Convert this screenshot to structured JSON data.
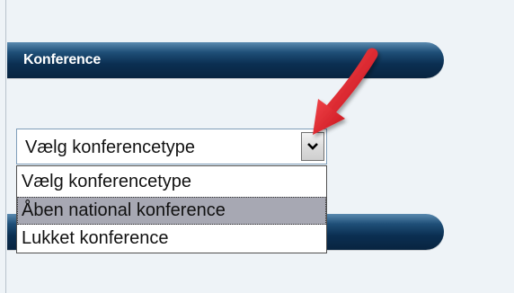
{
  "section_top": {
    "title": "Konference"
  },
  "section_bottom": {
    "title": ""
  },
  "conference_type_select": {
    "selected_value": "Vælg konferencetype",
    "options": [
      "Vælg konferencetype",
      "Åben national konference",
      "Lukket konference"
    ],
    "highlighted_option": "Åben national konference"
  },
  "colors": {
    "header_bar_dark": "#0b2f52",
    "header_bar_light": "#5a8ab0",
    "highlight_option_bg": "#a7a8b3",
    "annotation_arrow": "#e0242c",
    "page_background": "#eef3f7"
  },
  "icons": {
    "select_button_icon": "chevron-down-icon",
    "annotation": "arrow-pointer-icon"
  }
}
